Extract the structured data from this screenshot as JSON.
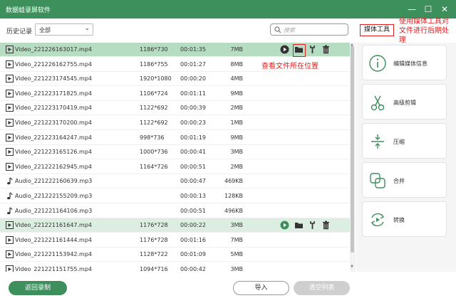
{
  "window": {
    "title": "数据蛙录屏软件",
    "minimize": "—",
    "maximize": "☐",
    "close": "✕"
  },
  "toolbar": {
    "history_label": "历史记录",
    "filter_value": "全部",
    "search_placeholder": "搜索"
  },
  "files": [
    {
      "type": "video",
      "name": "Video_221226163017.mp4",
      "resolution": "1186*730",
      "duration": "00:01:35",
      "size": "7MB",
      "state": "selected"
    },
    {
      "type": "video",
      "name": "Video_221226162755.mp4",
      "resolution": "1186*755",
      "duration": "00:01:27",
      "size": "8MB"
    },
    {
      "type": "video",
      "name": "Video_221223174545.mp4",
      "resolution": "1920*1080",
      "duration": "00:00:20",
      "size": "4MB"
    },
    {
      "type": "video",
      "name": "Video_221223171825.mp4",
      "resolution": "1106*724",
      "duration": "00:01:11",
      "size": "9MB"
    },
    {
      "type": "video",
      "name": "Video_221223170419.mp4",
      "resolution": "1122*692",
      "duration": "00:00:39",
      "size": "2MB"
    },
    {
      "type": "video",
      "name": "Video_221223170200.mp4",
      "resolution": "1122*692",
      "duration": "00:00:23",
      "size": "1MB"
    },
    {
      "type": "video",
      "name": "Video_221223164247.mp4",
      "resolution": "998*736",
      "duration": "00:01:19",
      "size": "9MB"
    },
    {
      "type": "video",
      "name": "Video_221223165126.mp4",
      "resolution": "1000*736",
      "duration": "00:00:41",
      "size": "3MB"
    },
    {
      "type": "video",
      "name": "Video_221222162945.mp4",
      "resolution": "1164*726",
      "duration": "00:00:51",
      "size": "2MB"
    },
    {
      "type": "audio",
      "name": "Audio_221222160639.mp3",
      "resolution": "",
      "duration": "00:00:47",
      "size": "469KB"
    },
    {
      "type": "audio",
      "name": "Audio_221222155209.mp3",
      "resolution": "",
      "duration": "00:00:13",
      "size": "128KB"
    },
    {
      "type": "audio",
      "name": "Audio_221221164106.mp3",
      "resolution": "",
      "duration": "00:00:51",
      "size": "496KB"
    },
    {
      "type": "video",
      "name": "Video_221221161647.mp4",
      "resolution": "1176*728",
      "duration": "00:00:22",
      "size": "3MB",
      "state": "hover"
    },
    {
      "type": "video",
      "name": "Video_221221161444.mp4",
      "resolution": "1176*728",
      "duration": "00:01:16",
      "size": "7MB"
    },
    {
      "type": "video",
      "name": "Video_221221153942.mp4",
      "resolution": "1128*722",
      "duration": "00:01:09",
      "size": "5MB"
    },
    {
      "type": "video",
      "name": "Video_221221151755.mp4",
      "resolution": "1094*716",
      "duration": "00:00:42",
      "size": "3MB"
    }
  ],
  "annotations": {
    "locate_file": "查看文件所在位置",
    "media_tools_note_line1": "使用媒体工具对",
    "media_tools_note_line2": "文件进行后期处",
    "media_tools_note_line3": "理"
  },
  "media_tools": {
    "title": "媒体工具",
    "items": [
      {
        "label": "编辑媒体信息",
        "icon": "info-icon"
      },
      {
        "label": "高级剪辑",
        "icon": "scissors-icon"
      },
      {
        "label": "压缩",
        "icon": "compress-icon"
      },
      {
        "label": "合并",
        "icon": "merge-icon"
      },
      {
        "label": "转换",
        "icon": "convert-icon"
      }
    ]
  },
  "footer": {
    "back_label": "返回录制",
    "import_label": "导入",
    "clear_label": "清空列表"
  },
  "colors": {
    "brand": "#3d8f5c",
    "selected_row": "#b6dcc1",
    "hover_row": "#dceee1",
    "annotation": "#e02020"
  }
}
